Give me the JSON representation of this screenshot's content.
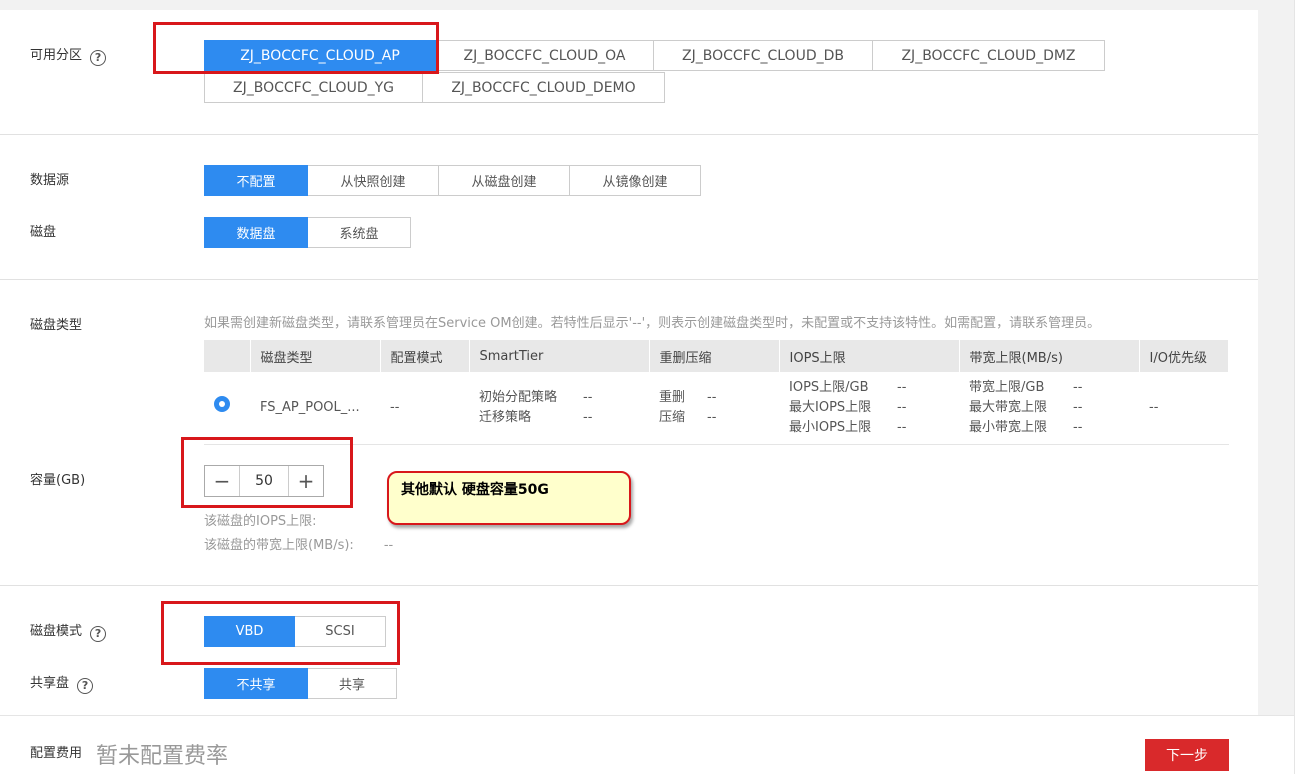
{
  "zone": {
    "label": "可用分区",
    "help_icon": "?",
    "options": [
      "ZJ_BOCCFC_CLOUD_AP",
      "ZJ_BOCCFC_CLOUD_OA",
      "ZJ_BOCCFC_CLOUD_DB",
      "ZJ_BOCCFC_CLOUD_DMZ",
      "ZJ_BOCCFC_CLOUD_YG",
      "ZJ_BOCCFC_CLOUD_DEMO"
    ],
    "selected": "ZJ_BOCCFC_CLOUD_AP"
  },
  "datasource": {
    "label": "数据源",
    "options": [
      "不配置",
      "从快照创建",
      "从磁盘创建",
      "从镜像创建"
    ],
    "selected": "不配置"
  },
  "disk": {
    "label": "磁盘",
    "options": [
      "数据盘",
      "系统盘"
    ],
    "selected": "数据盘"
  },
  "disk_type": {
    "label": "磁盘类型",
    "hint": "如果需创建新磁盘类型，请联系管理员在Service OM创建。若特性后显示'--'，则表示创建磁盘类型时，未配置或不支持该特性。如需配置，请联系管理员。",
    "columns": [
      "",
      "磁盘类型",
      "配置模式",
      "SmartTier",
      "重删压缩",
      "IOPS上限",
      "带宽上限(MB/s)",
      "I/O优先级"
    ],
    "row": {
      "name": "FS_AP_POOL_...",
      "config_mode": "--",
      "smarttier": [
        {
          "k": "初始分配策略",
          "v": "--"
        },
        {
          "k": "迁移策略",
          "v": "--"
        }
      ],
      "dedup": [
        {
          "k": "重删",
          "v": "--"
        },
        {
          "k": "压缩",
          "v": "--"
        }
      ],
      "iops": [
        {
          "k": "IOPS上限/GB",
          "v": "--"
        },
        {
          "k": "最大IOPS上限",
          "v": "--"
        },
        {
          "k": "最小IOPS上限",
          "v": "--"
        }
      ],
      "bandwidth": [
        {
          "k": "带宽上限/GB",
          "v": "--"
        },
        {
          "k": "最大带宽上限",
          "v": "--"
        },
        {
          "k": "最小带宽上限",
          "v": "--"
        }
      ],
      "io_priority": "--"
    }
  },
  "capacity": {
    "label": "容量(GB)",
    "value": "50",
    "minus": "−",
    "plus": "+",
    "iops_label": "该磁盘的IOPS上限:",
    "bandwidth_label": "该磁盘的带宽上限(MB/s):",
    "bandwidth_value": "--"
  },
  "annotation": {
    "text": "其他默认 硬盘容量50G"
  },
  "disk_mode": {
    "label": "磁盘模式",
    "help_icon": "?",
    "options": [
      "VBD",
      "SCSI"
    ],
    "selected": "VBD"
  },
  "shared": {
    "label": "共享盘",
    "help_icon": "?",
    "options": [
      "不共享",
      "共享"
    ],
    "selected": "不共享"
  },
  "footer": {
    "fee_label": "配置费用",
    "fee_value": "暂未配置费率",
    "next_label": "下一步"
  },
  "colors": {
    "accent": "#2e8bf0",
    "highlight_border": "#d8171b",
    "next_button": "#d9292b",
    "callout_bg": "#ffffcc"
  }
}
